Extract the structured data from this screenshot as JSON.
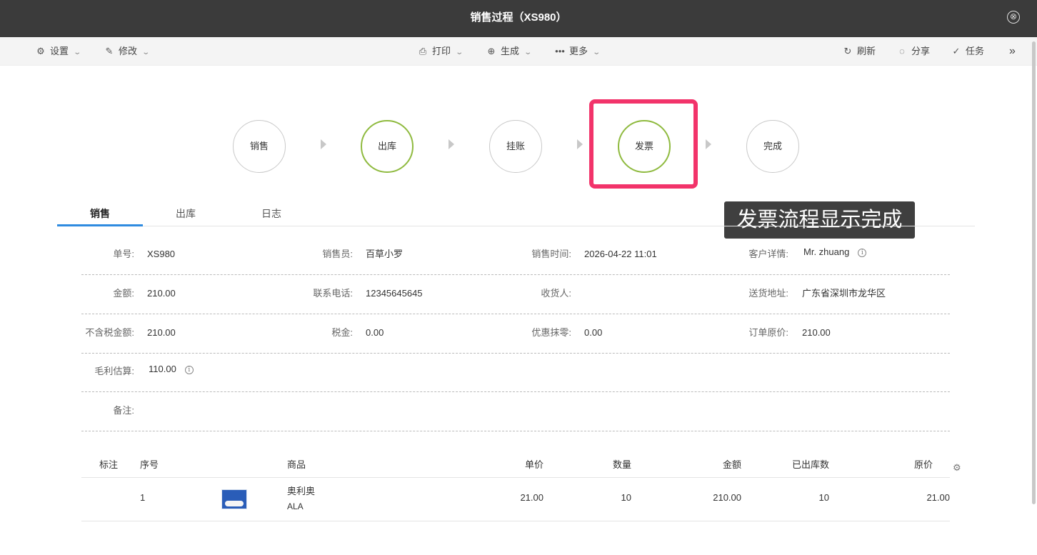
{
  "window": {
    "title": "销售过程（XS980）",
    "close_icon": "⊗"
  },
  "toolbar": {
    "settings": "设置",
    "edit": "修改",
    "print": "打印",
    "generate": "生成",
    "more": "更多",
    "refresh": "刷新",
    "share": "分享",
    "task": "任务",
    "expand": "»"
  },
  "steps": [
    {
      "label": "销售",
      "active": false
    },
    {
      "label": "出库",
      "active": true
    },
    {
      "label": "挂账",
      "active": false
    },
    {
      "label": "发票",
      "active": true
    },
    {
      "label": "完成",
      "active": false
    }
  ],
  "annotation": {
    "highlight_color": "#f2336a",
    "tooltip": "发票流程显示完成"
  },
  "tabs": [
    {
      "label": "销售",
      "active": true
    },
    {
      "label": "出库",
      "active": false
    },
    {
      "label": "日志",
      "active": false
    }
  ],
  "details": {
    "order_no_label": "单号:",
    "order_no": "XS980",
    "salesperson_label": "销售员:",
    "salesperson": "百草小罗",
    "sale_time_label": "销售时间:",
    "sale_time": "2026-04-22 11:01",
    "customer_label": "客户详情:",
    "customer": "Mr. zhuang",
    "amount_label": "金额:",
    "amount": "210.00",
    "phone_label": "联系电话:",
    "phone": "12345645645",
    "receiver_label": "收货人:",
    "receiver": "",
    "address_label": "送货地址:",
    "address": "广东省深圳市龙华区",
    "pretax_label": "不含税金额:",
    "pretax": "210.00",
    "tax_label": "税金:",
    "tax": "0.00",
    "discount_label": "优惠抹零:",
    "discount": "0.00",
    "original_price_label": "订单原价:",
    "original_price": "210.00",
    "profit_label": "毛利估算:",
    "profit": "110.00",
    "remark_label": "备注:",
    "remark": ""
  },
  "table": {
    "headers": {
      "mark": "标注",
      "seq": "序号",
      "product": "商品",
      "unit_price": "单价",
      "qty": "数量",
      "amount": "金额",
      "shipped": "已出库数",
      "original": "原价"
    },
    "rows": [
      {
        "mark": "",
        "seq": "1",
        "product_name": "奥利奥",
        "product_brand": "ALA",
        "unit_price": "21.00",
        "qty": "10",
        "amount": "210.00",
        "shipped": "10",
        "original": "21.00"
      }
    ]
  },
  "colors": {
    "accent_green": "#8fba3f",
    "tab_blue": "#2f8be0",
    "titlebar": "#3b3b3b"
  }
}
